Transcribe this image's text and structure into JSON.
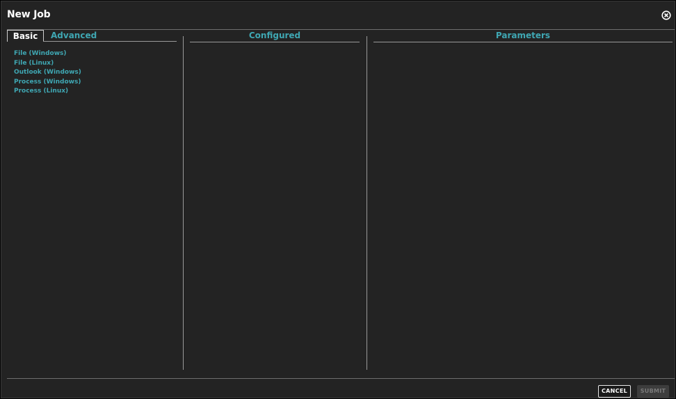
{
  "dialog": {
    "title": "New Job",
    "close_icon": "close-circle-icon"
  },
  "tabs": [
    {
      "label": "Basic",
      "active": true
    },
    {
      "label": "Advanced",
      "active": false
    }
  ],
  "job_types": [
    "File (Windows)",
    "File (Linux)",
    "Outlook (Windows)",
    "Process (Windows)",
    "Process (Linux)"
  ],
  "columns": {
    "configured": "Configured",
    "parameters": "Parameters"
  },
  "footer": {
    "cancel_label": "CANCEL",
    "submit_label": "SUBMIT",
    "submit_enabled": false
  },
  "colors": {
    "background": "#232323",
    "accent": "#3fa7b3",
    "text": "#ffffff"
  }
}
